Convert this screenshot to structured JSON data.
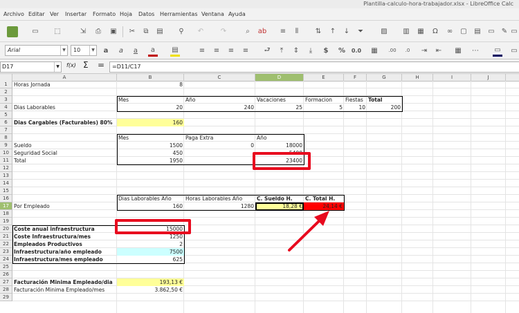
{
  "window": {
    "title": "Plantilla-calculo-hora-trabajador.xlsx - LibreOffice Calc"
  },
  "menu": [
    "Archivo",
    "Editar",
    "Ver",
    "Insertar",
    "Formato",
    "Hoja",
    "Datos",
    "Herramientas",
    "Ventana",
    "Ayuda"
  ],
  "toolbar": {
    "font_name": "Arial",
    "font_size": "10"
  },
  "formula_bar": {
    "cell_ref": "D17",
    "fx": "f(x)",
    "sum": "Σ",
    "eq": "=",
    "formula": "=D11/C17"
  },
  "columns": [
    "A",
    "B",
    "C",
    "D",
    "E",
    "F",
    "G",
    "H",
    "I",
    "J"
  ],
  "rows": [
    "1",
    "2",
    "3",
    "4",
    "5",
    "6",
    "7",
    "8",
    "9",
    "10",
    "11",
    "12",
    "13",
    "14",
    "15",
    "16",
    "17",
    "18",
    "19",
    "20",
    "21",
    "22",
    "23",
    "24",
    "25",
    "26",
    "27",
    "28",
    "29"
  ],
  "cells": {
    "a1": "Horas Jornada",
    "b1": "8",
    "b3": "Mes",
    "c3": "Año",
    "d3": "Vacaciones",
    "e3": "Formacion",
    "f3": "Fiestas",
    "g3": "Total",
    "a4": "Dias Laborables",
    "b4": "20",
    "c4": "240",
    "d4": "25",
    "e4": "5",
    "f4": "10",
    "g4": "200",
    "a6": "Dias Cargables (Facturables) 80%",
    "b6": "160",
    "b8": "Mes",
    "c8": "Paga Extra",
    "d8": "Año",
    "a9": "Sueldo",
    "b9": "1500",
    "c9": "0",
    "d9": "18000",
    "a10": "Seguridad Social",
    "b10": "450",
    "d10": "5400",
    "a11": "Total",
    "b11": "1950",
    "d11": "23400",
    "b16": "Dias Laborables Año",
    "c16": "Horas Laborables Año",
    "d16": "C. Sueldo H.",
    "e16": "C. Total H.",
    "a17": "Por Empleado",
    "b17": "160",
    "c17": "1280",
    "d17": "18,28 €",
    "e17": "24,14 €",
    "a20": "Coste anual infraestructura",
    "b20": "15000",
    "a21": "Coste Infraestructura/mes",
    "b21": "1250",
    "a22": "Empleados Productivos",
    "b22": "2",
    "a23": "Infraestructura/año empleado",
    "b23": "7500",
    "a24": " Infraestructura/mes empleado",
    "b24": "625",
    "a27": "Facturación Minima Empleado/dia",
    "b27": "193,13 €",
    "a28": "Facturación Minima Empleado/mes",
    "b28": "3.862,50 €"
  },
  "colors": {
    "highlight_yellow": "#ffff99",
    "highlight_cyan": "#ccffff",
    "red_cell": "#ff0000",
    "annotation_red": "#e8091e",
    "active_header": "#9fbf6f"
  }
}
